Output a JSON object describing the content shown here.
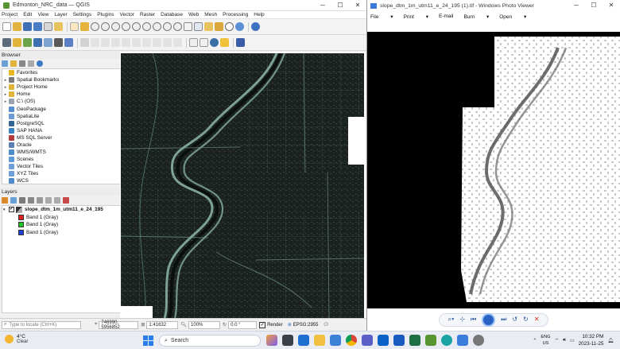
{
  "qgis": {
    "title": "Edmonton_NRC_data — QGIS",
    "menu": [
      "Project",
      "Edit",
      "View",
      "Layer",
      "Settings",
      "Plugins",
      "Vector",
      "Raster",
      "Database",
      "Web",
      "Mesh",
      "Processing",
      "Help"
    ],
    "browser_title": "Browser",
    "browser_items": [
      {
        "label": "Favorites",
        "icon": "star-icon",
        "color": "#e8b923",
        "arrow": ""
      },
      {
        "label": "Spatial Bookmarks",
        "icon": "bookmark-icon",
        "color": "#7a7a7a",
        "arrow": "▸"
      },
      {
        "label": "Project Home",
        "icon": "folder-icon",
        "color": "#e0b33b",
        "arrow": "▸"
      },
      {
        "label": "Home",
        "icon": "folder-icon",
        "color": "#e0b33b",
        "arrow": "▸"
      },
      {
        "label": "C:\\ (OS)",
        "icon": "drive-icon",
        "color": "#9aa3ad",
        "arrow": "▸"
      },
      {
        "label": "GeoPackage",
        "icon": "geopackage-icon",
        "color": "#5a8fcf",
        "arrow": ""
      },
      {
        "label": "SpatiaLite",
        "icon": "spatialite-icon",
        "color": "#6d9bd1",
        "arrow": ""
      },
      {
        "label": "PostgreSQL",
        "icon": "postgresql-icon",
        "color": "#336791",
        "arrow": ""
      },
      {
        "label": "SAP HANA",
        "icon": "sap-hana-icon",
        "color": "#3b83c4",
        "arrow": ""
      },
      {
        "label": "MS SQL Server",
        "icon": "mssql-icon",
        "color": "#b23b3b",
        "arrow": ""
      },
      {
        "label": "Oracle",
        "icon": "oracle-icon",
        "color": "#5a7fb5",
        "arrow": ""
      },
      {
        "label": "WMS/WMTS",
        "icon": "globe-icon",
        "color": "#4f8cc9",
        "arrow": ""
      },
      {
        "label": "Scenes",
        "icon": "scenes-icon",
        "color": "#5d9ad6",
        "arrow": ""
      },
      {
        "label": "Vector Tiles",
        "icon": "grid-icon",
        "color": "#6f9fd8",
        "arrow": ""
      },
      {
        "label": "XYZ Tiles",
        "icon": "grid-icon",
        "color": "#6f9fd8",
        "arrow": ""
      },
      {
        "label": "WCS",
        "icon": "globe-icon",
        "color": "#4f8cc9",
        "arrow": ""
      }
    ],
    "layers_title": "Layers",
    "layer": {
      "name": "slope_dtm_1m_utm11_e_24_195",
      "bands": [
        {
          "label": "Band 1 (Gray)",
          "color": "#e02020"
        },
        {
          "label": "Band 1 (Gray)",
          "color": "#22c522"
        },
        {
          "label": "Band 1 (Gray)",
          "color": "#1f3fd8"
        }
      ]
    },
    "status": {
      "locate_placeholder": "Type to locate (Ctrl+K)",
      "coordinate": "746990, 5956852",
      "scale": "1:41632",
      "magnifier": "100%",
      "rotation": "0.0 °",
      "render_label": "Render",
      "crs": "EPSG:2955"
    }
  },
  "viewer": {
    "title": "slope_dtm_1m_utm11_e_24_195 (1).tif - Windows Photo Viewer",
    "menu": [
      "File",
      "Print",
      "E-mail",
      "Burn",
      "Open"
    ]
  },
  "taskbar": {
    "temperature": "4°C",
    "weather": "Clear",
    "search_label": "Search",
    "lang1": "ENG",
    "lang2": "US",
    "time": "10:32 PM",
    "date": "2023-11-25"
  },
  "colors": {
    "qgis_green": "#589632",
    "map_dark": "#1a211f",
    "map_line": "#8fb8a8",
    "viewer_blue": "#2a62c4"
  }
}
